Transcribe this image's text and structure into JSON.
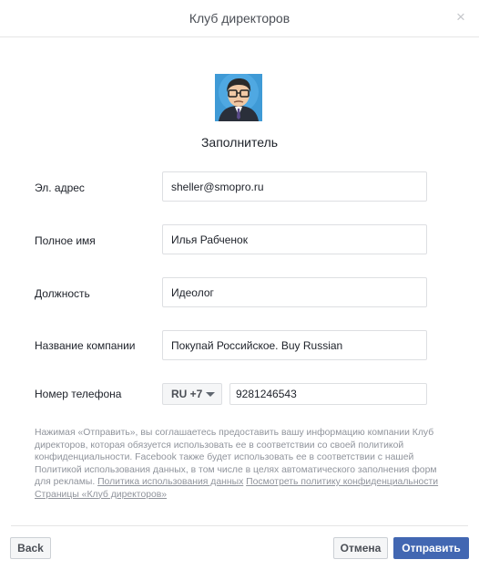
{
  "dialog": {
    "title": "Клуб директоров",
    "close_icon": "×"
  },
  "author": {
    "avatar_icon": "author-avatar",
    "name": "Заполнитель"
  },
  "form": {
    "email": {
      "label": "Эл. адрес",
      "value": "sheller@smopro.ru"
    },
    "full_name": {
      "label": "Полное имя",
      "value": "Илья Рабченок"
    },
    "job_title": {
      "label": "Должность",
      "value": "Идеолог"
    },
    "company": {
      "label": "Название компании",
      "value": "Покупай Российское. Buy Russian"
    },
    "phone": {
      "label": "Номер телефона",
      "country_code": "RU +7",
      "value": "9281246543"
    }
  },
  "disclaimer": {
    "text": "Нажимая «Отправить», вы соглашаетесь предоставить вашу информацию компании Клуб директоров, которая обязуется использовать ее в соответствии со своей политикой конфиденциальности. Facebook также будет использовать ее в соответствии с нашей Политикой использования данных, в том числе в целях автоматического заполнения форм для рекламы.",
    "link_data_policy": "Политика использования данных",
    "link_page_policy": "Посмотреть политику конфиденциальности Страницы «Клуб директоров»"
  },
  "footer": {
    "back_label": "Back",
    "cancel_label": "Отмена",
    "submit_label": "Отправить"
  },
  "colors": {
    "primary": "#4267b2",
    "border": "#dddfe2",
    "muted_text": "#90949c"
  }
}
